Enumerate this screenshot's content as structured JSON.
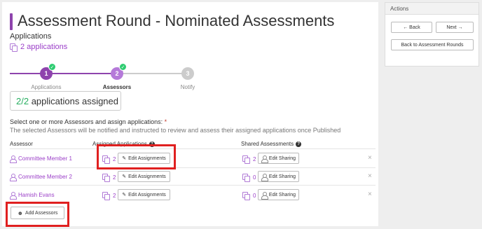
{
  "title": "Assessment Round - Nominated Assessments",
  "applications": {
    "label": "Applications",
    "link_text": "2 applications"
  },
  "stepper": {
    "steps": [
      {
        "number": "1",
        "label": "Applications",
        "done": true
      },
      {
        "number": "2",
        "label": "Assessors",
        "done": true
      },
      {
        "number": "3",
        "label": "Notify",
        "done": false
      }
    ],
    "check_glyph": "✓"
  },
  "summary": {
    "ratio": "2/2",
    "text": " applications assigned"
  },
  "instructions": {
    "line1": "Select one or more Assessors and assign applications: ",
    "required_mark": "*",
    "line2": "The selected Assessors will be notified and instructed to review and assess their assigned applications once Published"
  },
  "table": {
    "headers": {
      "assessor": "Assessor",
      "assigned": "Assigned Applications",
      "shared": "Shared Assessments"
    },
    "help_glyph": "?",
    "edit_assignments_label": "Edit Assignments",
    "edit_sharing_label": "Edit Sharing",
    "remove_glyph": "×",
    "rows": [
      {
        "name": "Committee Member 1",
        "assigned": "2",
        "shared": "2"
      },
      {
        "name": "Committee Member 2",
        "assigned": "2",
        "shared": "0"
      },
      {
        "name": "Hamish Evans",
        "assigned": "2",
        "shared": "0"
      }
    ]
  },
  "add_assessors_label": "Add Assessors",
  "actions": {
    "header": "Actions",
    "back_label": "← Back",
    "next_label": "Next →",
    "back_to_rounds_label": "Back to Assessment Rounds"
  },
  "colors": {
    "accent": "#9b3fc8",
    "check": "#2ecc71",
    "highlight": "#e02020"
  }
}
